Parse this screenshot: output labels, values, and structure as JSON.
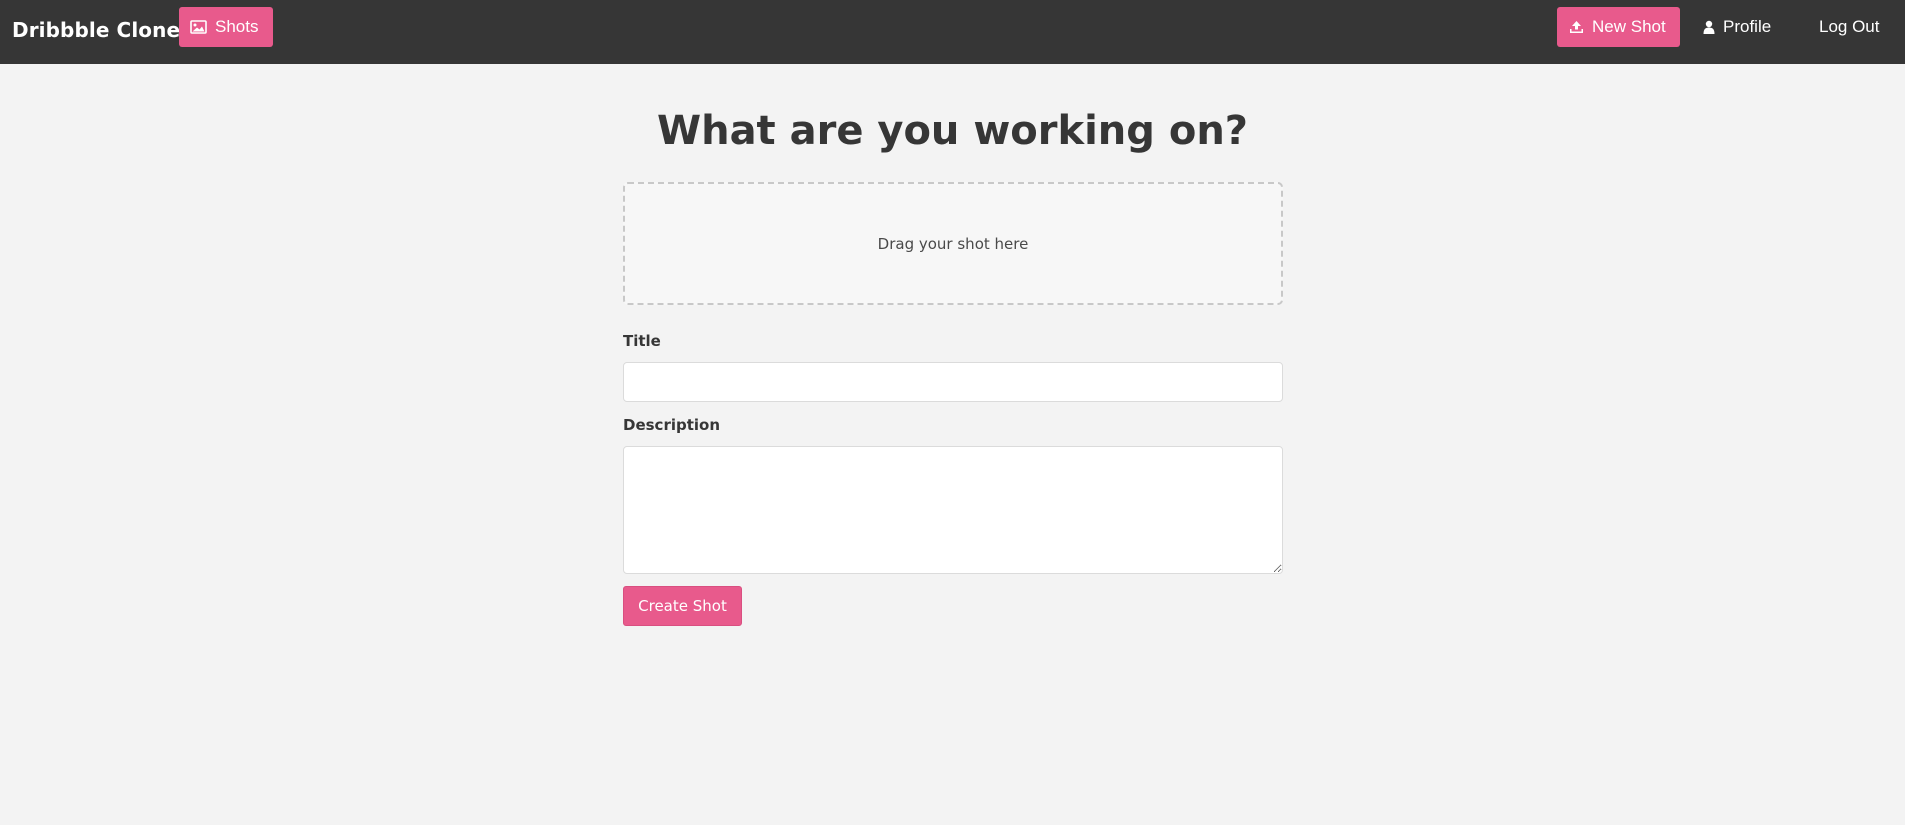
{
  "navbar": {
    "brand": "Dribbble Clone",
    "shots_label": "Shots",
    "new_shot_label": "New Shot",
    "profile_label": "Profile",
    "logout_label": "Log Out",
    "icons": {
      "shots": "image-icon",
      "new_shot": "upload-icon",
      "profile": "user-icon"
    }
  },
  "main": {
    "title": "What are you working on?",
    "dropzone_text": "Drag your shot here",
    "title_label": "Title",
    "title_value": "",
    "description_label": "Description",
    "description_value": "",
    "submit_label": "Create Shot"
  },
  "colors": {
    "navbar_bg": "#363636",
    "accent": "#e85a8c",
    "page_bg": "#f3f3f3"
  }
}
